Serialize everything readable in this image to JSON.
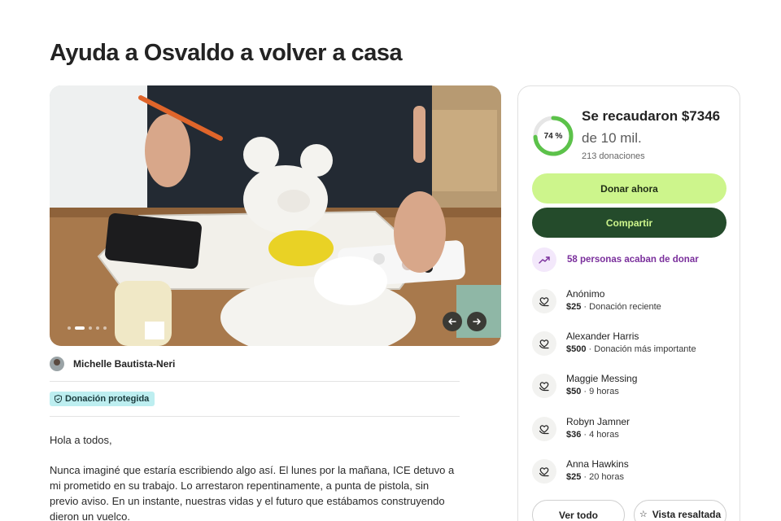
{
  "page": {
    "title": "Ayuda a Osvaldo a volver a casa"
  },
  "organizer": {
    "name": "Michelle Bautista-Neri"
  },
  "badge": {
    "label": "Donación protegida"
  },
  "story": {
    "paragraphs": [
      "Hola a todos,",
      "Nunca imaginé que estaría escribiendo algo así. El lunes por la mañana, ICE detuvo a mi prometido en su trabajo. Lo arrestaron repentinamente, a punta de pistola, sin previo aviso. En un instante, nuestras vidas y el futuro que estábamos construyendo dieron un vuelco."
    ]
  },
  "carousel": {
    "slide_count": 5,
    "active_index": 1,
    "prev_icon": "arrow-left-icon",
    "next_icon": "arrow-right-icon"
  },
  "donation_summary": {
    "progress_percent": 74,
    "progress_label": "74 %",
    "raised_text": "Se recaudaron $7346",
    "goal_text": "de 10 mil.",
    "donations_count_text": "213 donaciones"
  },
  "actions": {
    "donate_label": "Donar ahora",
    "share_label": "Compartir"
  },
  "trending": {
    "text": "58 personas acaban de donar",
    "icon": "trending-up-icon"
  },
  "donors": [
    {
      "name": "Anónimo",
      "amount": "$25",
      "detail": " · Donación reciente"
    },
    {
      "name": "Alexander Harris",
      "amount": "$500",
      "detail": " · Donación más importante"
    },
    {
      "name": "Maggie Messing",
      "amount": "$50",
      "detail": " · 9 horas"
    },
    {
      "name": "Robyn Jamner",
      "amount": "$36",
      "detail": " · 4 horas"
    },
    {
      "name": "Anna Hawkins",
      "amount": "$25",
      "detail": " · 20 horas"
    }
  ],
  "footer_buttons": {
    "see_all_label": "Ver todo",
    "featured_label": "Vista resaltada"
  },
  "colors": {
    "accent_lime": "#cdf58c",
    "accent_dark_green": "#244b2b",
    "progress_green": "#5cc24a",
    "trend_purple": "#7a2f9c",
    "badge_teal": "#bdeef0"
  }
}
